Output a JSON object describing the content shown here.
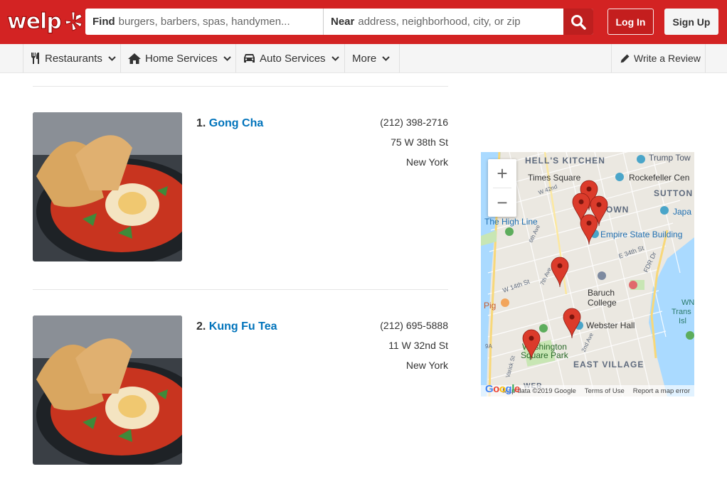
{
  "header": {
    "logo_text": "welp",
    "search": {
      "find_label": "Find",
      "find_placeholder": "burgers, barbers, spas, handymen...",
      "near_label": "Near",
      "near_placeholder": "address, neighborhood, city, or zip"
    },
    "login_label": "Log In",
    "signup_label": "Sign Up",
    "brand_color": "#d32323"
  },
  "nav": {
    "items": [
      {
        "label": "Restaurants",
        "icon": "utensils-icon"
      },
      {
        "label": "Home Services",
        "icon": "house-icon"
      },
      {
        "label": "Auto Services",
        "icon": "car-icon"
      },
      {
        "label": "More",
        "icon": ""
      }
    ],
    "write_review_label": "Write a Review"
  },
  "results": [
    {
      "rank": "1.",
      "name": "Gong Cha",
      "phone": "(212) 398-2716",
      "address": "75 W 38th St",
      "city": "New York"
    },
    {
      "rank": "2.",
      "name": "Kung Fu Tea",
      "phone": "(212) 695-5888",
      "address": "11 W 32nd St",
      "city": "New York"
    }
  ],
  "map": {
    "labels": {
      "hells_kitchen": "HELL'S KITCHEN",
      "trump_tower": "Trump Tow",
      "times_square": "Times Square",
      "rockefeller": "Rockefeller Cen",
      "sutton": "SUTTON",
      "japan": "Japa",
      "midtown": "OWN",
      "high_line": "The High Line",
      "empire_state": "Empire State Building",
      "baruch": "Baruch",
      "college": "College",
      "pig": "Pig",
      "webster_hall": "Webster Hall",
      "washington": "Washington",
      "square_park": "Square Park",
      "east_village": "EAST VILLAGE",
      "wn": "WN",
      "trans": "Trans",
      "isl": "Isl",
      "fdr": "FDR Dr",
      "w42": "W 42nd",
      "e34": "E 34th St",
      "w14": "W 14th St",
      "seventh": "7th Ave",
      "sixth": "6th Ave",
      "varick": "Varick St",
      "second": "2nd Ave",
      "ninea": "9A",
      "lower": "WER"
    },
    "zoom_in": "+",
    "zoom_out": "−",
    "google": "Google",
    "attribution": "Map data ©2019 Google",
    "terms": "Terms of Use",
    "report": "Report a map error"
  }
}
